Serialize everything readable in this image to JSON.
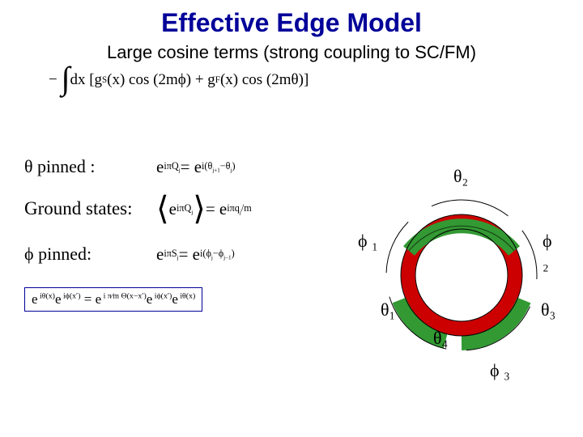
{
  "title": "Effective Edge Model",
  "subtitle": "Large cosine terms (strong coupling to SC/FM)",
  "eq_hamiltonian_html": "−&nbsp;<span class='int'>∫</span> dx [g<sub>S</sub> (x) cos (2mϕ) + g<sub>F</sub> (x) cos (2mθ)]",
  "label_theta_pinned": "θ pinned :",
  "eq_theta_html": "e<sup> iπQ<sub>j</sub></sup> = e<sup> i(θ<sub>j+1</sub>−θ<sub>j</sub>)</sup>",
  "label_ground": "Ground states:",
  "eq_ground_html": "<span class='angle'>⟨</span>e<sup> iπQ<sub>j</sub></sup><span class='angle'>⟩</span> = e<sup> iπq<sub>j</sub>/m</sup>",
  "label_phi_pinned": "ϕ pinned:",
  "eq_phi_html": "e<sup> iπS<sub>j</sub></sup> = e<sup> i(ϕ<sub>j</sub>−ϕ<sub>j−1</sub>)</sup>",
  "eq_boxed_html": "e<sup> iθ(x)</sup>e<sup> iϕ(x′)</sup> = e<sup> i&nbsp;π⁄m&nbsp;Θ(x−x′)</sup>e<sup> iϕ(x′)</sup>e<sup> iθ(x)</sup>",
  "diagram": {
    "theta2": "θ₂",
    "theta1": "θ₁",
    "theta4": "θ₄",
    "theta3": "θ₃",
    "phi1": "ϕ ₁",
    "phi2": "ϕ ₂",
    "phi3": "ϕ ₃"
  }
}
